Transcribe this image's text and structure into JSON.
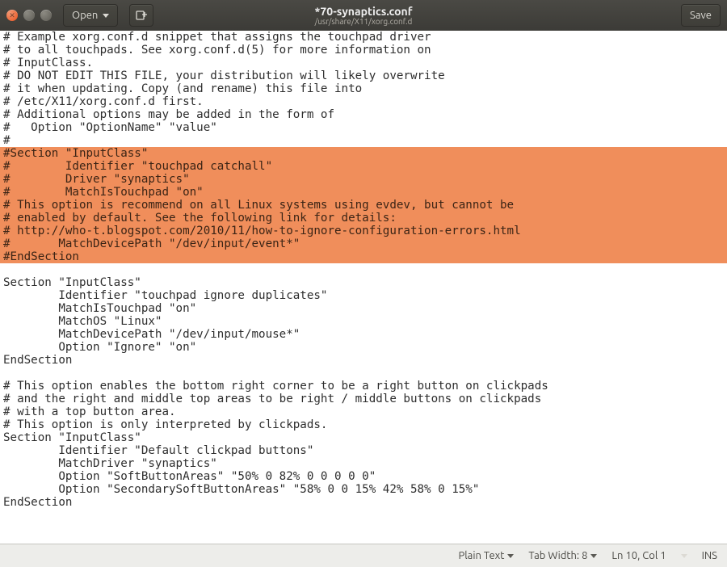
{
  "titlebar": {
    "open_label": "Open",
    "title": "*70-synaptics.conf",
    "subtitle": "/usr/share/X11/xorg.conf.d",
    "save_label": "Save"
  },
  "editor": {
    "lines": [
      {
        "text": "# Example xorg.conf.d snippet that assigns the touchpad driver",
        "sel": false
      },
      {
        "text": "# to all touchpads. See xorg.conf.d(5) for more information on",
        "sel": false
      },
      {
        "text": "# InputClass.",
        "sel": false
      },
      {
        "text": "# DO NOT EDIT THIS FILE, your distribution will likely overwrite",
        "sel": false
      },
      {
        "text": "# it when updating. Copy (and rename) this file into",
        "sel": false
      },
      {
        "text": "# /etc/X11/xorg.conf.d first.",
        "sel": false
      },
      {
        "text": "# Additional options may be added in the form of",
        "sel": false
      },
      {
        "text": "#   Option \"OptionName\" \"value\"",
        "sel": false
      },
      {
        "text": "#",
        "sel": false
      },
      {
        "text": "#Section \"InputClass\"",
        "sel": true
      },
      {
        "text": "#        Identifier \"touchpad catchall\"",
        "sel": true
      },
      {
        "text": "#        Driver \"synaptics\"",
        "sel": true
      },
      {
        "text": "#        MatchIsTouchpad \"on\"",
        "sel": true
      },
      {
        "text": "# This option is recommend on all Linux systems using evdev, but cannot be",
        "sel": true
      },
      {
        "text": "# enabled by default. See the following link for details:",
        "sel": true
      },
      {
        "text": "# http://who-t.blogspot.com/2010/11/how-to-ignore-configuration-errors.html",
        "sel": true
      },
      {
        "text": "#       MatchDevicePath \"/dev/input/event*\"",
        "sel": true
      },
      {
        "text": "#EndSection",
        "sel": true
      },
      {
        "text": "",
        "sel": false
      },
      {
        "text": "Section \"InputClass\"",
        "sel": false
      },
      {
        "text": "        Identifier \"touchpad ignore duplicates\"",
        "sel": false
      },
      {
        "text": "        MatchIsTouchpad \"on\"",
        "sel": false
      },
      {
        "text": "        MatchOS \"Linux\"",
        "sel": false
      },
      {
        "text": "        MatchDevicePath \"/dev/input/mouse*\"",
        "sel": false
      },
      {
        "text": "        Option \"Ignore\" \"on\"",
        "sel": false
      },
      {
        "text": "EndSection",
        "sel": false
      },
      {
        "text": "",
        "sel": false
      },
      {
        "text": "# This option enables the bottom right corner to be a right button on clickpads",
        "sel": false
      },
      {
        "text": "# and the right and middle top areas to be right / middle buttons on clickpads",
        "sel": false
      },
      {
        "text": "# with a top button area.",
        "sel": false
      },
      {
        "text": "# This option is only interpreted by clickpads.",
        "sel": false
      },
      {
        "text": "Section \"InputClass\"",
        "sel": false
      },
      {
        "text": "        Identifier \"Default clickpad buttons\"",
        "sel": false
      },
      {
        "text": "        MatchDriver \"synaptics\"",
        "sel": false
      },
      {
        "text": "        Option \"SoftButtonAreas\" \"50% 0 82% 0 0 0 0 0\"",
        "sel": false
      },
      {
        "text": "        Option \"SecondarySoftButtonAreas\" \"58% 0 0 15% 42% 58% 0 15%\"",
        "sel": false
      },
      {
        "text": "EndSection",
        "sel": false
      }
    ]
  },
  "statusbar": {
    "syntax": "Plain Text",
    "tabwidth": "Tab Width: 8",
    "position": "Ln 10, Col 1",
    "insert_mode": "INS"
  }
}
